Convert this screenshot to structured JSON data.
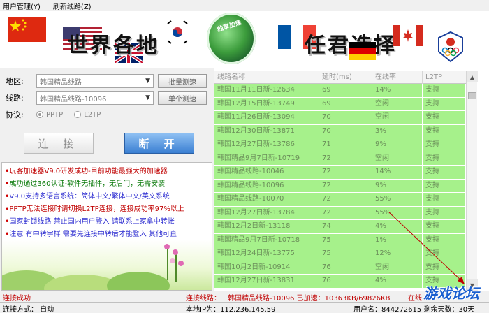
{
  "menu": [
    {
      "label": "用户管理(Y)"
    },
    {
      "label": "刷新线路(Z)"
    }
  ],
  "banner": {
    "text_left": "世界各地",
    "text_right": "任君选择",
    "globe_text": "独享加速"
  },
  "form": {
    "region_label": "地区:",
    "region_value": "韩国精品线路",
    "batch_test": "批量测速",
    "line_label": "线路:",
    "line_value": "韩国精品线路-10096",
    "single_test": "单个测速",
    "protocol_label": "协议:",
    "protocols": [
      {
        "label": "PPTP",
        "selected": true
      },
      {
        "label": "L2TP",
        "selected": false
      }
    ]
  },
  "actions": {
    "connect": "连 接",
    "disconnect": "断 开"
  },
  "news": [
    {
      "text": "玩客加速器V9.0研发成功-目前功能最强大的加速器",
      "color": "#c00000"
    },
    {
      "text": "成功通过360认证-软件无插件，无后门，无需安装",
      "color": "#0a7a0a"
    },
    {
      "text": "V9.0支持多语言系统：简体中文/繁体中文/英文系统",
      "color": "#2a2ad0"
    },
    {
      "text": "PPTP无法连接时请切换L2TP连接，连接成功率97%以上",
      "color": "#c00000"
    },
    {
      "text": "国家封锁线路  禁止国内用户登入  请联系上家拿中转帐",
      "color": "#2a2ad0"
    },
    {
      "text": "注意  有中转字样  需要先连接中转后才能登入  其他可直",
      "color": "#2a2ad0"
    }
  ],
  "table": {
    "headers": [
      "线路名称",
      "延时(ms)",
      "在线率",
      "L2TP"
    ],
    "rows": [
      [
        "韩国11月11日新-12634",
        "69",
        "14%",
        "支持"
      ],
      [
        "韩国12月15日新-13749",
        "69",
        "空闲",
        "支持"
      ],
      [
        "韩国11月26日新-13094",
        "70",
        "空闲",
        "支持"
      ],
      [
        "韩国12月30日新-13871",
        "70",
        "3%",
        "支持"
      ],
      [
        "韩国12月27日新-13786",
        "71",
        "9%",
        "支持"
      ],
      [
        "韩国精品9月7日新-10719",
        "72",
        "空闲",
        "支持"
      ],
      [
        "韩国精品线路-10046",
        "72",
        "14%",
        "支持"
      ],
      [
        "韩国精品线路-10096",
        "72",
        "9%",
        "支持"
      ],
      [
        "韩国精品线路-10070",
        "72",
        "55%",
        "支持"
      ],
      [
        "韩国12月27日新-13784",
        "72",
        "55%",
        "支持"
      ],
      [
        "韩国12月2日新-13118",
        "74",
        "4%",
        "支持"
      ],
      [
        "韩国精品9月7日新-10718",
        "75",
        "1%",
        "支持"
      ],
      [
        "韩国12月24日新-13775",
        "75",
        "12%",
        "支持"
      ],
      [
        "韩国10月2日新-10914",
        "76",
        "空闲",
        "支持"
      ],
      [
        "韩国12月27日新-13831",
        "76",
        "4%",
        "支持"
      ]
    ]
  },
  "status": {
    "message": "连接成功",
    "accelerated_prefix": "连接线路：",
    "accelerated": "韩国精品线路-10096 已加速：10363KB/69826KB",
    "online_prefix": "在线",
    "mode": "连接方式：  自动",
    "local_ip": "本地IP为：112.236.145.59",
    "user": "用户名：844272615    剩余天数：30天"
  },
  "watermark": "游戏论坛",
  "colors": {
    "row_green": "#a6f18b",
    "status_red": "#c00000",
    "disconnect_blue": "#3a7fd2"
  }
}
